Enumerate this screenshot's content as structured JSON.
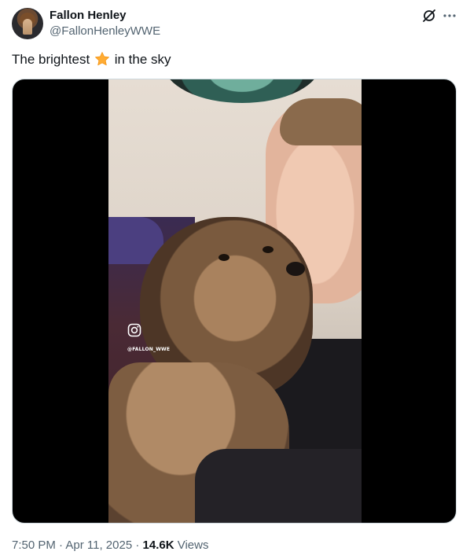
{
  "author": {
    "display_name": "Fallon Henley",
    "handle": "@FallonHenleyWWE"
  },
  "header_icons": [
    "grok-icon",
    "more-options-icon"
  ],
  "tweet": {
    "text_before_emoji": "The brightest",
    "emoji": "star-emoji",
    "text_after_emoji": "in the sky"
  },
  "media": {
    "type": "video",
    "watermark_icon": "instagram-icon",
    "watermark_handle": "@FALLON_WWE"
  },
  "meta": {
    "time": "7:50 PM",
    "separator": " · ",
    "date": "Apr 11, 2025",
    "views_count": "14.6K",
    "views_label": " Views"
  },
  "colors": {
    "text_primary": "#0f1419",
    "text_secondary": "#536471",
    "star": "#ffac33",
    "media_background": "#000000"
  }
}
